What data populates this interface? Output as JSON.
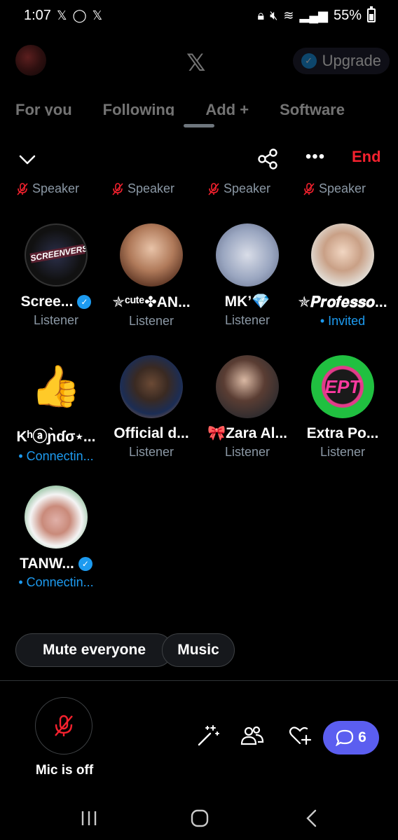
{
  "status_bar": {
    "time": "1:07",
    "battery_percent": "55%"
  },
  "background_app": {
    "upgrade_label": "Upgrade",
    "tabs": [
      "For you",
      "Following",
      "Add +",
      "Software"
    ]
  },
  "space": {
    "end_label": "End",
    "speakers": [
      "Speaker",
      "Speaker",
      "Speaker",
      "Speaker"
    ],
    "participants": [
      {
        "name": "Scree...",
        "role": "Listener",
        "verified": true
      },
      {
        "name": "✯ᶜᵘᵗᵉ✤AN...",
        "role": "Listener",
        "verified": false
      },
      {
        "name": "MK’💎",
        "role": "Listener",
        "verified": false
      },
      {
        "name": "✯𝑷𝒓𝒐𝒇𝒆𝒔𝒔𝒐...",
        "role": "• Invited",
        "verified": false
      },
      {
        "name": "Kʰⓐɲ̀ɗσ٭...",
        "role": "• Connectin...",
        "verified": false
      },
      {
        "name": "Official d...",
        "role": "Listener",
        "verified": false
      },
      {
        "name": "🎀Zara Al...",
        "role": "Listener",
        "verified": false
      },
      {
        "name": "Extra Po...",
        "role": "Listener",
        "verified": false
      },
      {
        "name": "TANW...",
        "role": "• Connectin...",
        "verified": true
      }
    ],
    "mute_everyone_label": "Mute everyone",
    "music_label": "Music",
    "mic_label": "Mic is off",
    "chat_count": "6",
    "colors": {
      "accent_blue": "#1d9bf0",
      "end_red": "#f4212e",
      "chat_purple": "#5b5ef0"
    }
  }
}
